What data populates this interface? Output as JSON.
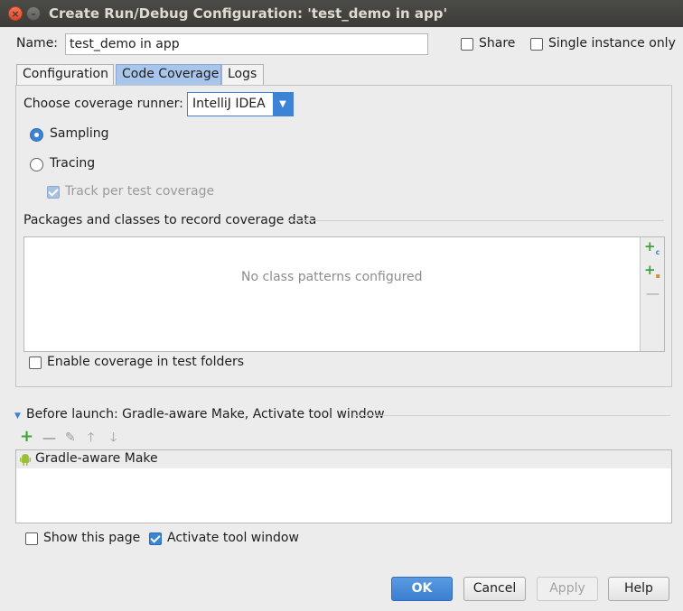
{
  "window": {
    "title": "Create Run/Debug Configuration: 'test_demo in app'"
  },
  "name_row": {
    "label": "Name:",
    "value": "test_demo in app",
    "share_label": "Share",
    "single_instance_label": "Single instance only"
  },
  "tabs": [
    {
      "label": "Configuration"
    },
    {
      "label": "Code Coverage"
    },
    {
      "label": "Logs"
    }
  ],
  "coverage": {
    "runner_label": "Choose coverage runner:",
    "runner_value": "IntelliJ IDEA",
    "sampling_label": "Sampling",
    "tracing_label": "Tracing",
    "track_per_test_label": "Track per test coverage",
    "packages_label": "Packages and classes to record coverage data",
    "empty_text": "No class patterns configured",
    "enable_in_tests_label": "Enable coverage in test folders"
  },
  "before_launch": {
    "header": "Before launch: Gradle-aware Make, Activate tool window",
    "items": [
      {
        "label": "Gradle-aware Make"
      }
    ]
  },
  "footer": {
    "show_page_label": "Show this page",
    "activate_tool_label": "Activate tool window"
  },
  "buttons": {
    "ok": "OK",
    "cancel": "Cancel",
    "apply": "Apply",
    "help": "Help"
  },
  "colors": {
    "accent": "#3c83d6",
    "add_green": "#3aa33a",
    "android_green": "#9bbf3a"
  }
}
